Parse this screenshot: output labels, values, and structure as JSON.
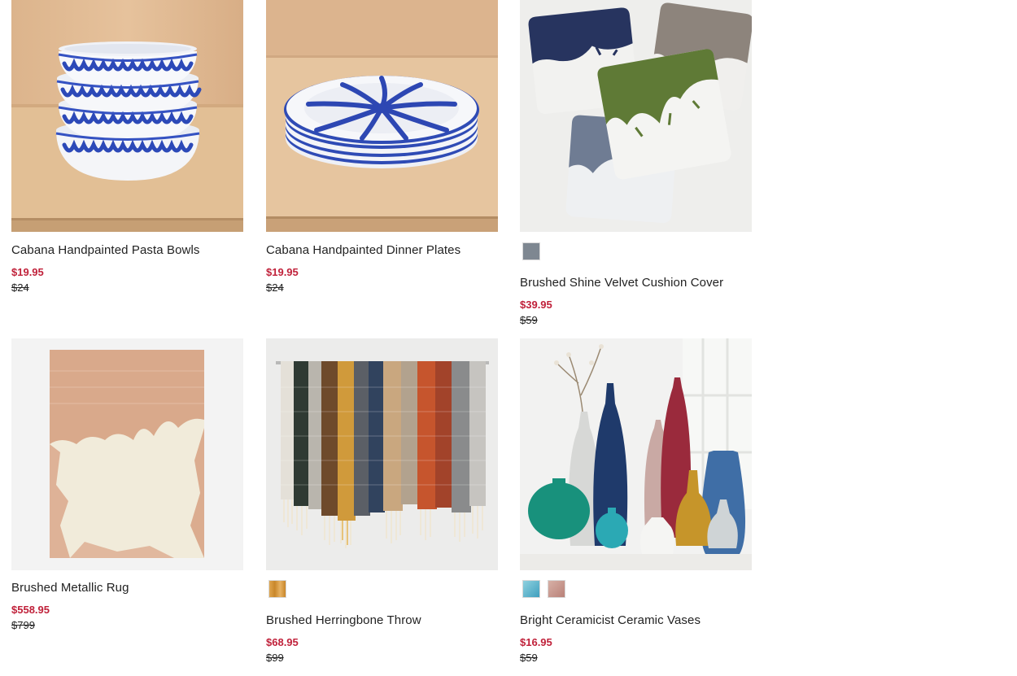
{
  "products": [
    {
      "name": "Cabana Handpainted Pasta Bowls",
      "sale_price": "$19.95",
      "original_price": "$24",
      "image": "pasta-bowls-image",
      "swatches": []
    },
    {
      "name": "Cabana Handpainted Dinner Plates",
      "sale_price": "$19.95",
      "original_price": "$24",
      "image": "dinner-plates-image",
      "swatches": []
    },
    {
      "name": "Brushed Shine Velvet Cushion Cover",
      "sale_price": "$39.95",
      "original_price": "$59",
      "image": "cushion-covers-image",
      "swatches": [
        "#7e8791"
      ]
    },
    {
      "name": "Brushed Metallic Rug",
      "sale_price": "$558.95",
      "original_price": "$799",
      "image": "metallic-rug-image",
      "swatches": []
    },
    {
      "name": "Brushed Herringbone Throw",
      "sale_price": "$68.95",
      "original_price": "$99",
      "image": "herringbone-throws-image",
      "swatches": [
        "#d99a3a"
      ]
    },
    {
      "name": "Bright Ceramicist Ceramic Vases",
      "sale_price": "$16.95",
      "original_price": "$59",
      "image": "ceramic-vases-image",
      "swatches": [
        "#5eb8cf",
        "#c89b91"
      ]
    }
  ],
  "colors": {
    "sale": "#c0213a",
    "text": "#222222"
  }
}
